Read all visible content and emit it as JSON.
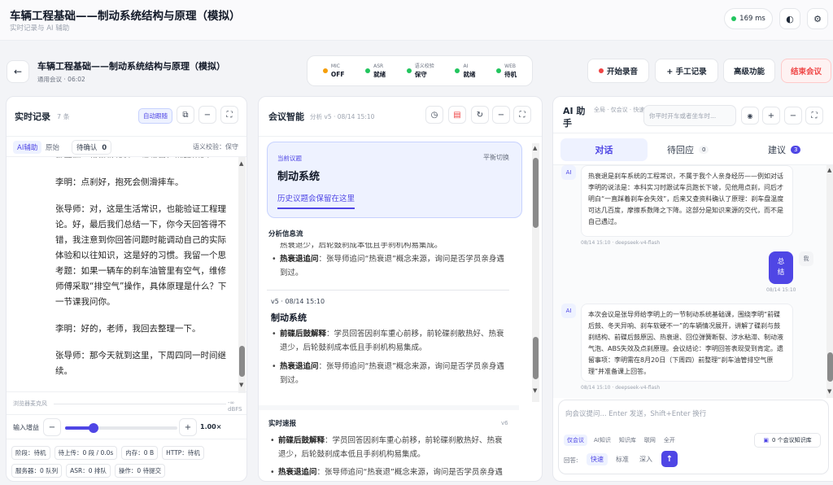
{
  "app": {
    "title": "车辆工程基础——制动系统结构与原理（模拟）",
    "subtitle": "实时记录与 AI 辅助",
    "latency": "169 ms"
  },
  "meeting": {
    "title": "车辆工程基础——制动系统结构与原理（模拟）",
    "type": "通用会议",
    "sep": "·",
    "time": "06:02"
  },
  "status": [
    {
      "label": "MIC",
      "value": "OFF",
      "color": "#f59e0b"
    },
    {
      "label": "ASR",
      "value": "就绪",
      "color": "#22c55e"
    },
    {
      "label": "语义校验",
      "value": "保守",
      "color": "#22c55e"
    },
    {
      "label": "AI",
      "value": "就绪",
      "color": "#22c55e"
    },
    {
      "label": "WEB",
      "value": "待机",
      "color": "#22c55e"
    }
  ],
  "actions": {
    "record": "开始录音",
    "manual": "+ 手工记录",
    "advanced": "高级功能",
    "end": "结束会议"
  },
  "transcript": {
    "title": "实时记录",
    "count": "7 条",
    "auto": "自动跟随",
    "tabs": [
      "AI辅助",
      "原始"
    ],
    "pending_label": "待确认",
    "pending_count": "0",
    "check": "语义校验：保守",
    "paragraphs": [
      "李明：点刹好，抱死会侧滑摔车。",
      "张导师：对，这是生活常识，也能验证工程理论。好，最后我们总结一下，你今天回答得不错，我注意到你回答问题时能调动自己的实际体验和以往知识，这是好的习惯。我留一个思考题：如果一辆车的刹车油管里有空气，维修师傅采取“排空气”操作，具体原理是什么？下一节课我问你。",
      "李明：好的，老师，我回去整理一下。",
      "张导师：那今天就到这里，下周四同一时间继续。"
    ],
    "wave_label": "浏览器麦克风",
    "wave_db": "-∞ dBFS",
    "gain_label": "输入增益",
    "gain_value": "1.00×",
    "gain_level": 0.25,
    "stats": [
      [
        "阶段：待机",
        "待上传：0 段 / 0.0s",
        "内存：0 B",
        "HTTP：待机"
      ],
      [
        "服务器：0 队列",
        "ASR：0 排队",
        "操作：0 待提交"
      ]
    ]
  },
  "intel": {
    "title": "会议智能",
    "meta": "分析 v5 · 08/14 15:10",
    "topic_label": "当前议题",
    "topic_switch": "平衡切换",
    "topic": "制动系统",
    "topic_tab": "历史议题会保留在这里",
    "flow_title": "分析信息流",
    "flow_top_lines": [
      "热衰退少，后轮鼓刹成本低且手刹机构易集成。"
    ],
    "flow_top_bullet": {
      "head": "热衰退追问",
      "body": "：张导师追问“热衰退”概念来源，询问是否学员亲身遇到过。"
    },
    "v5_meta": "v5 · 08/14 15:10",
    "v5_title": "制动系统",
    "v5_bullets": [
      {
        "head": "前碟后鼓解释",
        "body": "：学员回答因刹车重心前移，前轮碟刹散热好、热衰退少，后轮鼓刹成本低且手刹机构易集成。"
      },
      {
        "head": "热衰退追问",
        "body": "：张导师追问“热衰退”概念来源，询问是否学员亲身遇到过。"
      }
    ],
    "quick_title": "实时速报",
    "quick_ver": "v6",
    "quick_bullets": [
      {
        "head": "前碟后鼓解释",
        "body": "：学员回答因刹车重心前移，前轮碟刹散热好、热衰退少，后轮鼓刹成本低且手刹机构易集成。"
      },
      {
        "head": "热衰退追问",
        "body": "：张导师追问“热衰退”概念来源，询问是否学员亲身遇到过。"
      }
    ]
  },
  "ai": {
    "title": "AI 助手",
    "scope": "全局 · 仅会议 · 快速",
    "input_placeholder": "你平时开车或者坐车时...",
    "tabs": {
      "chat": "对话",
      "pending": "待回应",
      "pending_count": "0",
      "suggest": "建议",
      "suggest_count": "3"
    },
    "msg1": "热衰退是刹车系统的工程常识，不属于我个人亲身经历——例如对话李明的说法是：本科实习时跟试车员跑长下坡，见他用点刹，问后才明白“一直踩着刹车会失效”，后来又查资料确认了原理：刹车盘温度可达几百度，摩擦系数降之下降。这部分是知识来源的交代，而不是自己遇过。",
    "msg1_meta": "08/14 15:10 · deepseek-v4-flash",
    "user_msg": "总结",
    "user_meta": "08/14 15:10",
    "user_avatar": "我",
    "msg2": "本次会议是张导师给李明上的一节制动系统基础课，围绕李明“前碟后鼓、冬天异响、刹车软硬不一”的车辆情况展开，讲解了碟刹与鼓刹结构、前碟后鼓原因、热衰退、回位弹簧断裂、涉水粘滞、制动液气泡、ABS失效及点刹原理。会议结论：李明回答表现受到肯定。遗留事项：李明需在8月20日（下周四）前整理“刹车油管排空气原理”并准备课上回答。",
    "msg2_meta": "08/14 15:10 · deepseek-v4-flash",
    "ai_avatar": "AI",
    "compose_placeholder": "向会议提问... Enter 发送，Shift+Enter 换行",
    "filters": [
      "仅会议",
      "AI知识",
      "知识库",
      "联网",
      "全开"
    ],
    "kb": "0 个会议知识库",
    "reply_label": "回答:",
    "modes": [
      "快速",
      "标准",
      "深入"
    ],
    "send": "↑"
  },
  "colors": {
    "accent": "#4f46e5",
    "end": "#ef4444",
    "record_dot": "#ef4444",
    "pill": "#eef2ff"
  }
}
